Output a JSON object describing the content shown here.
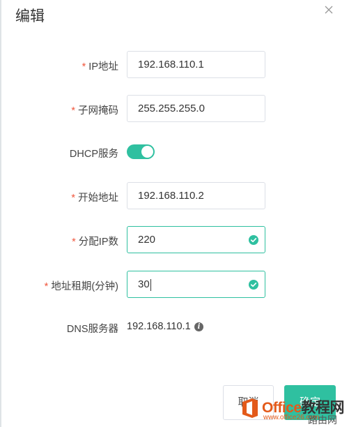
{
  "dialog": {
    "title": "编辑",
    "close_icon": "close-icon"
  },
  "form": {
    "required_mark": "*",
    "ip": {
      "label": "IP地址",
      "value": "192.168.110.1"
    },
    "subnet": {
      "label": "子网掩码",
      "value": "255.255.255.0"
    },
    "dhcp": {
      "label": "DHCP服务",
      "enabled": true
    },
    "start": {
      "label": "开始地址",
      "value": "192.168.110.2"
    },
    "count": {
      "label": "分配IP数",
      "value": "220"
    },
    "lease": {
      "label": "地址租期(分钟)",
      "value": "30"
    },
    "dns": {
      "label": "DNS服务器",
      "value": "192.168.110.1",
      "info_icon": "info-icon"
    }
  },
  "footer": {
    "cancel_label": "取消",
    "ok_label": "确定"
  },
  "watermark": {
    "brand_main": "Office",
    "brand_suffix": "教程网",
    "url": "www.office26.com",
    "extra": "路由网"
  },
  "colors": {
    "accent": "#2fc0a0",
    "required": "#f0573e"
  }
}
